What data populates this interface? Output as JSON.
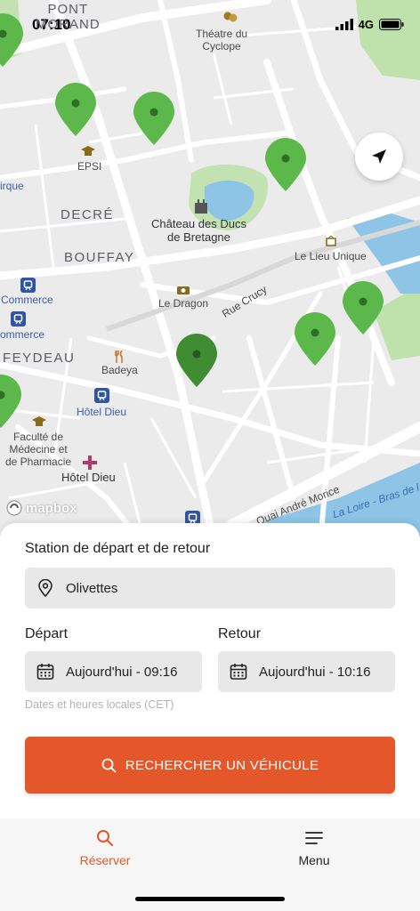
{
  "status_bar": {
    "time": "07:10",
    "network": "4G"
  },
  "map": {
    "labels": {
      "pont_morand": "PONT\nMORAND",
      "theatre": "Théatre du\nCyclope",
      "epsi": "EPSI",
      "cirque": "irque",
      "decre": "DECRÉ",
      "chateau": "Château des Ducs\nde Bretagne",
      "bouffay": "BOUFFAY",
      "lieu_unique": "Le Lieu Unique",
      "commerce1": "Commerce",
      "commerce2": "ommerce",
      "le_dragon": "Le Dragon",
      "rue_crucy": "Rue Crucy",
      "feydeau": "FEYDEAU",
      "badeya": "Badeya",
      "hotel_dieu_station": "Hôtel Dieu",
      "faculte": "Faculté de\nMédecine et\nde Pharmacie",
      "hotel_dieu": "Hôtel Dieu",
      "quai": "Quai André Morice",
      "loire": "La Loire - Bras de l"
    },
    "mapbox_label": "mapbox",
    "pin_colors": {
      "normal": "#5cb84a",
      "selected": "#3f8c33"
    }
  },
  "booking": {
    "station_title": "Station de départ et de retour",
    "station_value": "Olivettes",
    "depart_title": "Départ",
    "depart_value": "Aujourd'hui - 09:16",
    "retour_title": "Retour",
    "retour_value": "Aujourd'hui - 10:16",
    "hint": "Dates et heures locales (CET)",
    "search_label": "RECHERCHER UN VÉHICULE"
  },
  "tabs": {
    "reserver": "Réserver",
    "menu": "Menu"
  },
  "colors": {
    "accent": "#e4572a",
    "map_bg": "#ececec",
    "water": "#8ec4e6",
    "park": "#b9dfa8"
  }
}
